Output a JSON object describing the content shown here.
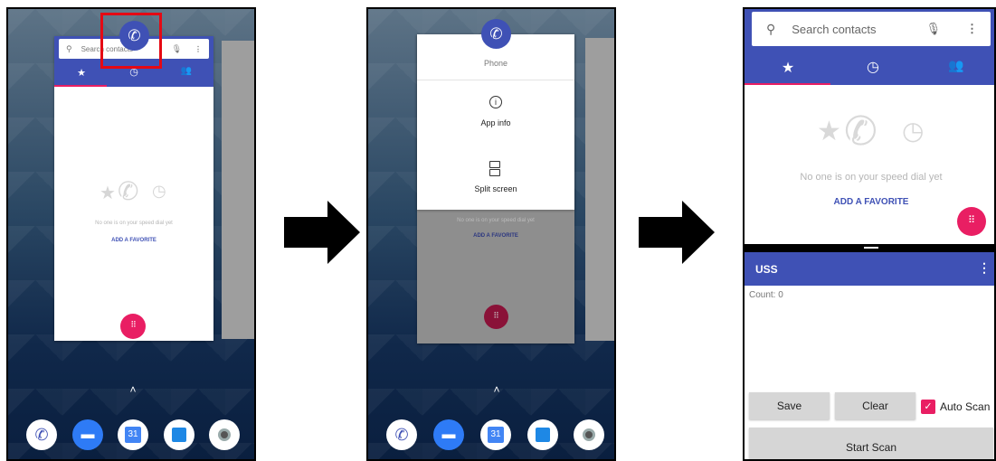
{
  "panel1": {
    "search_placeholder": "Search contacts",
    "empty_text": "No one is on your speed dial yet",
    "add_favorite": "ADD A FAVORITE"
  },
  "panel2": {
    "app_name": "Phone",
    "menu": [
      {
        "label": "App info",
        "icon": "info-icon"
      },
      {
        "label": "Split screen",
        "icon": "split-screen-icon"
      }
    ],
    "empty_text": "No one is on your speed dial yet",
    "add_favorite": "ADD A FAVORITE"
  },
  "panel3": {
    "search_placeholder": "Search contacts",
    "empty_text": "No one is on your speed dial yet",
    "add_favorite": "ADD A FAVORITE",
    "app_title": "USS",
    "count_label": "Count:",
    "count_value": "0",
    "save": "Save",
    "clear": "Clear",
    "auto_scan": "Auto Scan",
    "auto_scan_checked": true,
    "start_scan": "Start Scan"
  },
  "dock": {
    "calendar_day": "31",
    "icons": [
      "phone-icon",
      "messages-icon",
      "calendar-icon",
      "contacts-icon",
      "camera-icon"
    ]
  },
  "colors": {
    "primary": "#3f51b5",
    "accent": "#e91e63",
    "highlight": "#e50914"
  }
}
